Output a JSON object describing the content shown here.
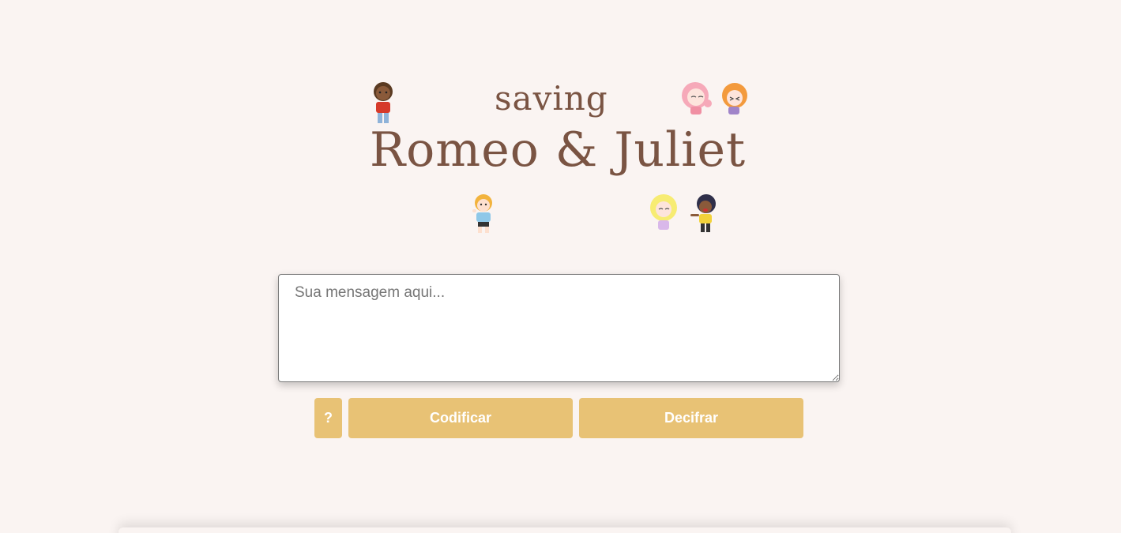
{
  "logo": {
    "line1": "saving",
    "line2": "Romeo & Juliet",
    "characters": [
      "boy-red-shirt-icon",
      "pink-hair-girl-icon",
      "orange-hair-girl-icon",
      "blond-boy-icon",
      "blonde-girl-icon",
      "dark-hair-boy-icon"
    ]
  },
  "message": {
    "placeholder": "Sua mensagem aqui...",
    "value": ""
  },
  "buttons": {
    "help": "?",
    "encode": "Codificar",
    "decode": "Decifrar"
  },
  "colors": {
    "background": "#faf4f2",
    "button": "#e8c275",
    "logo_text": "#7a5443"
  }
}
